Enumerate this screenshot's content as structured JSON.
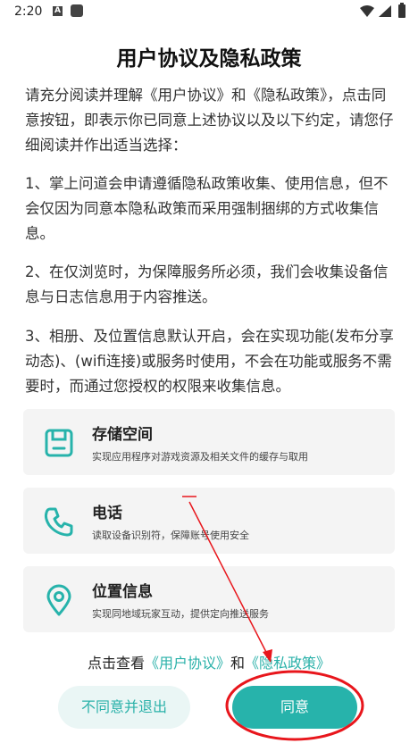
{
  "status": {
    "time": "2:20",
    "notif_letter": "A"
  },
  "dialog": {
    "title": "用户协议及隐私政策",
    "paragraphs": [
      "请充分阅读并理解《用户协议》和《隐私政策》，点击同意按钮，即表示你已同意上述协议以及以下约定，请您仔细阅读并作出适当选择：",
      "1、掌上问道会申请遵循隐私政策收集、使用信息，但不会仅因为同意本隐私政策而采用强制捆绑的方式收集信息。",
      "2、在仅浏览时，为保障服务所必须，我们会收集设备信息与日志信息用于内容推送。",
      "3、相册、及位置信息默认开启，会在实现功能(发布分享动态)、(wifi连接)或服务时使用，不会在功能或服务不需要时，而通过您授权的权限来收集信息。"
    ],
    "permissions": [
      {
        "title": "存储空间",
        "desc": "实现应用程序对游戏资源及相关文件的缓存与取用",
        "icon": "storage-icon"
      },
      {
        "title": "电话",
        "desc": "读取设备识别符，保障账号使用安全",
        "icon": "phone-icon"
      },
      {
        "title": "位置信息",
        "desc": "实现同地域玩家互动，提供定向推送服务",
        "icon": "location-pin-icon"
      }
    ],
    "links": {
      "prefix": "点击查看",
      "user_agreement": "《用户协议》",
      "connector": "和",
      "privacy_policy": "《隐私政策》"
    },
    "buttons": {
      "decline": "不同意并退出",
      "agree": "同意"
    }
  },
  "colors": {
    "accent": "#27b3ab",
    "annotation": "#e8161c",
    "card_bg": "#f4f4f4"
  }
}
